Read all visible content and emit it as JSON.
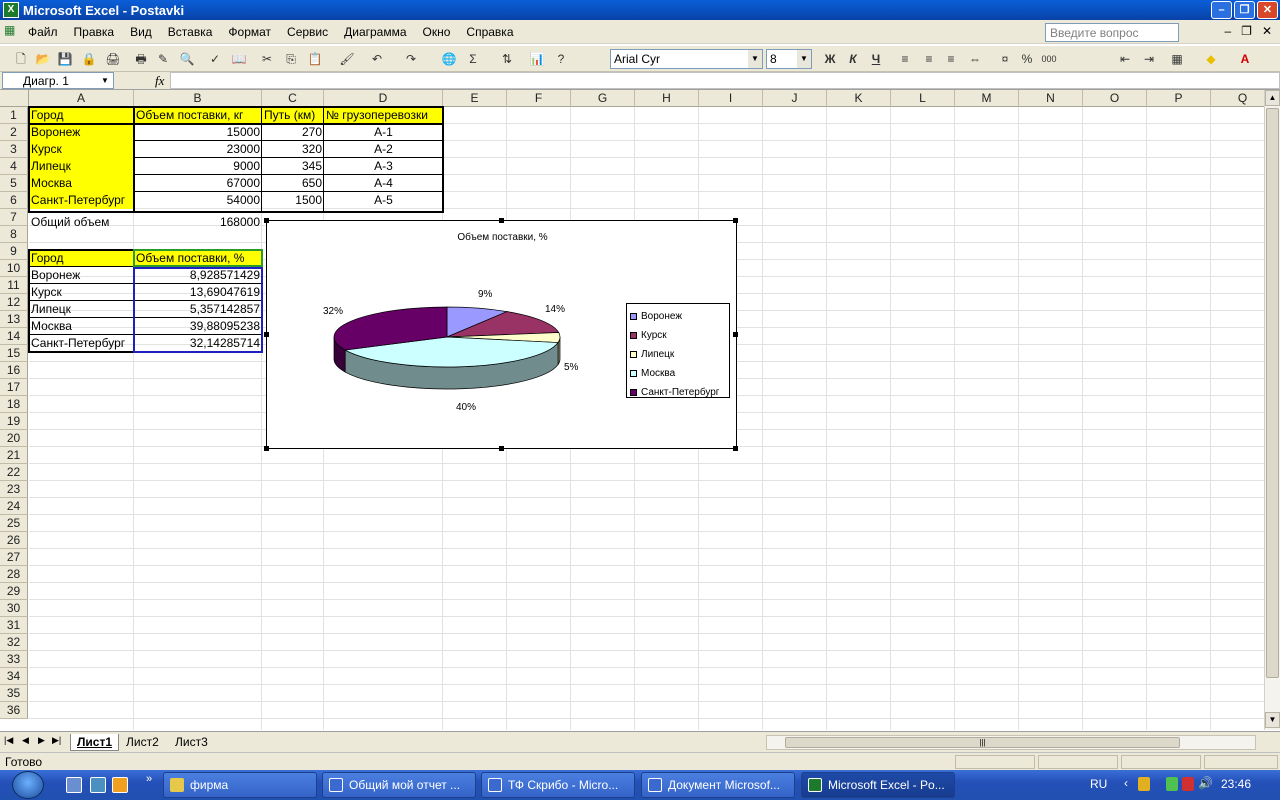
{
  "window": {
    "title": "Microsoft Excel - Postavki",
    "app_icon": "excel-icon"
  },
  "menu": {
    "items": [
      "Файл",
      "Правка",
      "Вид",
      "Вставка",
      "Формат",
      "Сервис",
      "Диаграмма",
      "Окно",
      "Справка"
    ],
    "help_placeholder": "Введите вопрос"
  },
  "toolbar": {
    "font_name": "Arial Cyr",
    "font_size": "8",
    "bold": "Ж",
    "italic": "К",
    "underline": "Ч"
  },
  "formula_bar": {
    "name_box": "Диагр. 1",
    "fx": "fx",
    "formula": ""
  },
  "columns": [
    "A",
    "B",
    "C",
    "D",
    "E",
    "F",
    "G",
    "H",
    "I",
    "J",
    "K",
    "L",
    "M",
    "N",
    "O",
    "P",
    "Q"
  ],
  "rows": [
    "1",
    "2",
    "3",
    "4",
    "5",
    "6",
    "7",
    "8",
    "9",
    "10",
    "11",
    "12",
    "13",
    "14",
    "15",
    "16",
    "17",
    "18",
    "19",
    "20",
    "21",
    "22",
    "23",
    "24",
    "25",
    "26",
    "27",
    "28",
    "29",
    "30",
    "31",
    "32",
    "33",
    "34",
    "35",
    "36"
  ],
  "table1": {
    "headers": [
      "Город",
      "Объем поставки, кг",
      "Путь (км)",
      "№ грузоперевозки"
    ],
    "rows": [
      [
        "Воронеж",
        "15000",
        "270",
        "А-1"
      ],
      [
        "Курск",
        "23000",
        "320",
        "А-2"
      ],
      [
        "Липецк",
        "9000",
        "345",
        "А-3"
      ],
      [
        "Москва",
        "67000",
        "650",
        "А-4"
      ],
      [
        "Санкт-Петербург",
        "54000",
        "1500",
        "А-5"
      ]
    ],
    "total_label": "Общий объем",
    "total_value": "168000"
  },
  "table2": {
    "headers": [
      "Город",
      "Объем поставки, %"
    ],
    "rows": [
      [
        "Воронеж",
        "8,928571429"
      ],
      [
        "Курск",
        "13,69047619"
      ],
      [
        "Липецк",
        "5,357142857"
      ],
      [
        "Москва",
        "39,88095238"
      ],
      [
        "Санкт-Петербург",
        "32,14285714"
      ]
    ]
  },
  "chart_data": {
    "type": "pie",
    "title": "Объем поставки, %",
    "categories": [
      "Воронеж",
      "Курск",
      "Липецк",
      "Москва",
      "Санкт-Петербург"
    ],
    "values": [
      8.928571429,
      13.69047619,
      5.357142857,
      39.88095238,
      32.14285714
    ],
    "data_labels": [
      "9%",
      "14%",
      "5%",
      "40%",
      "32%"
    ],
    "colors": [
      "#9999ff",
      "#993366",
      "#ffffcc",
      "#ccffff",
      "#660066"
    ],
    "legend_position": "right"
  },
  "sheets": {
    "tabs": [
      "Лист1",
      "Лист2",
      "Лист3"
    ],
    "active": "Лист1"
  },
  "status": {
    "text": "Готово"
  },
  "taskbar": {
    "tasks": [
      "фирма",
      "Общий мой отчет ...",
      "ТФ Скрибо - Micro...",
      "Документ Microsof...",
      "Microsoft Excel - Po..."
    ],
    "lang": "RU",
    "clock": "23:46"
  }
}
